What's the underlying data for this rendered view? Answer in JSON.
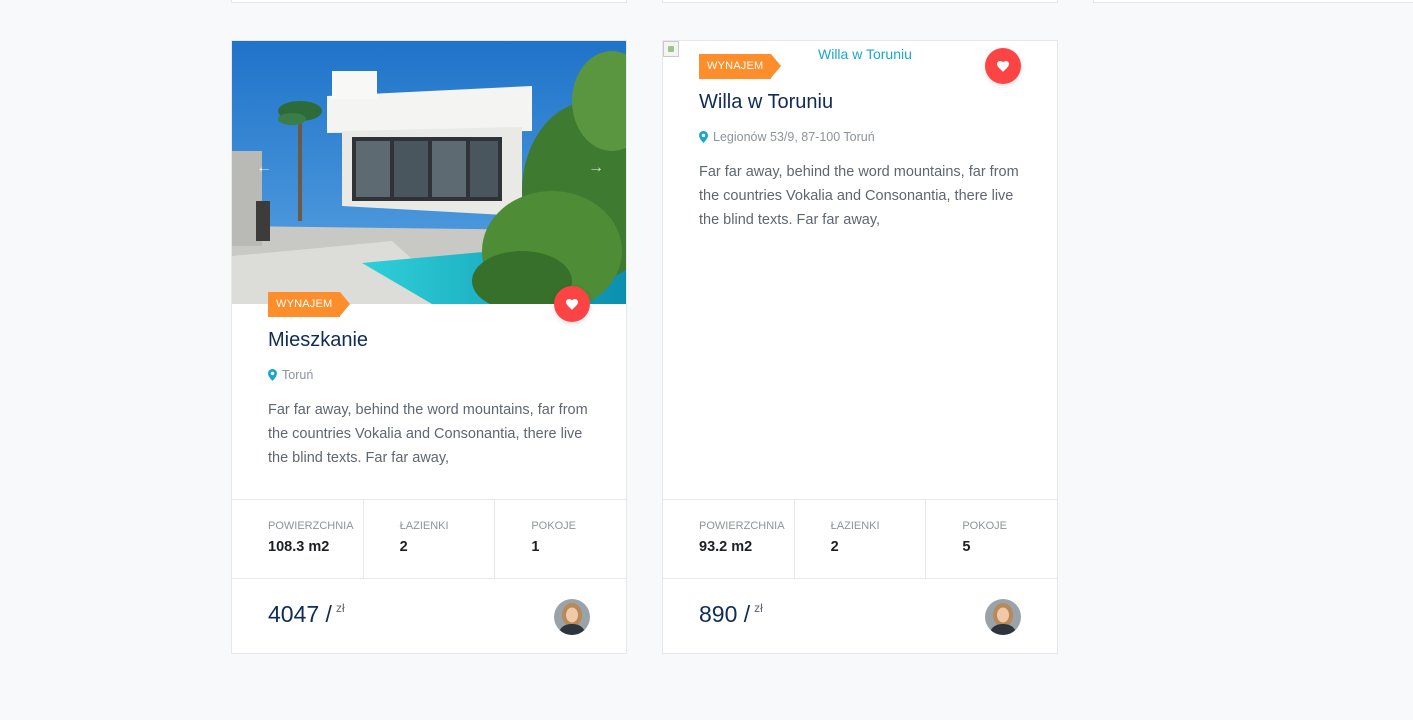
{
  "listings": [
    {
      "image_alt": "",
      "image_loaded": true,
      "badge": "Wynajem",
      "title": "Mieszkanie",
      "location": "Toruń",
      "description": "Far far away, behind the word mountains, far from the countries Vokalia and Consonantia, there live the blind texts. Far far away,",
      "stats": [
        {
          "label": "Powierzchnia",
          "value": "108.3 m2"
        },
        {
          "label": "Łazienki",
          "value": "2"
        },
        {
          "label": "Pokoje",
          "value": "1"
        }
      ],
      "price": "4047 /",
      "currency": "zł",
      "prev_arrow": "←",
      "next_arrow": "→"
    },
    {
      "image_alt": "Willa w Toruniu",
      "image_loaded": false,
      "badge": "Wynajem",
      "title": "Willa w Toruniu",
      "location": "Legionów 53/9, 87-100 Toruń",
      "description": "Far far away, behind the word mountains, far from the countries Vokalia and Consonantia, there live the blind texts. Far far away,",
      "stats": [
        {
          "label": "Powierzchnia",
          "value": "93.2 m2"
        },
        {
          "label": "Łazienki",
          "value": "2"
        },
        {
          "label": "Pokoje",
          "value": "5"
        }
      ],
      "price": "890 /",
      "currency": "zł"
    }
  ],
  "icons": {
    "favorite": "heart-icon",
    "location": "map-pin-icon",
    "agent": "avatar"
  },
  "colors": {
    "badge": "#fd8e2b",
    "favorite": "#fd4444",
    "title": "#0e2c57",
    "pin": "#1aa6d1"
  }
}
